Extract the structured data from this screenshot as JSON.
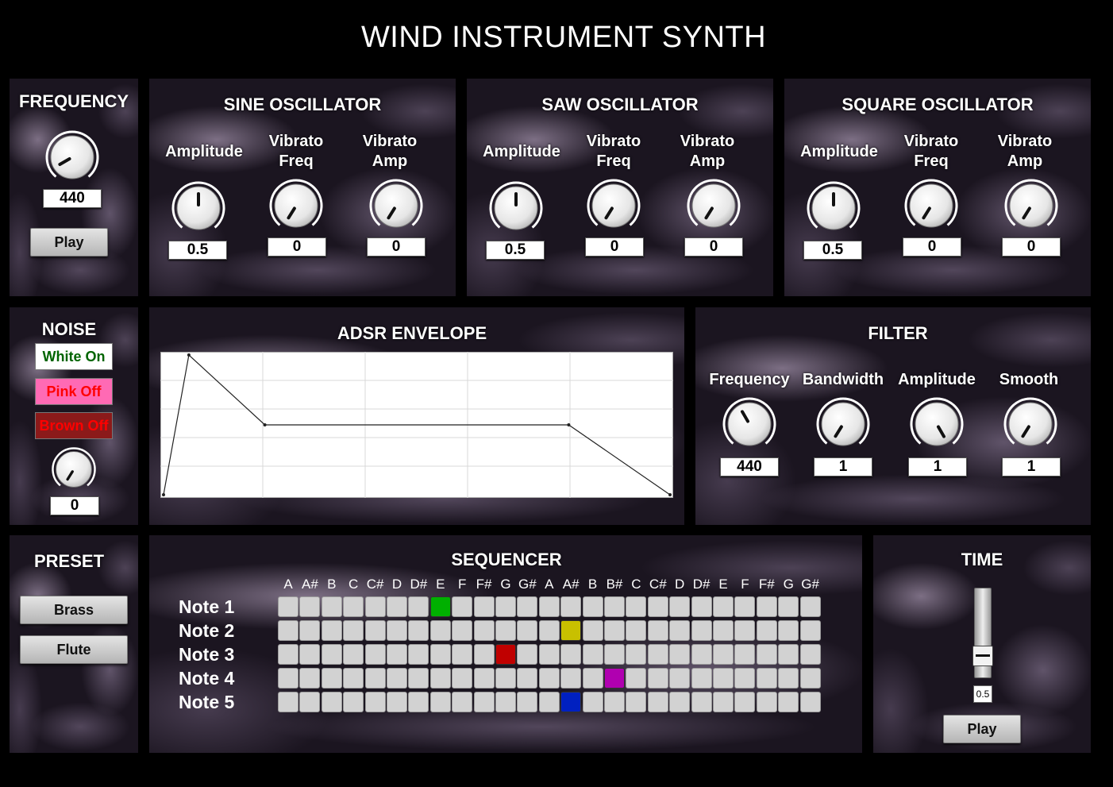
{
  "app_title": "WIND INSTRUMENT SYNTH",
  "frequency": {
    "title": "FREQUENCY",
    "value": "440",
    "play_label": "Play"
  },
  "sine": {
    "title": "SINE OSCILLATOR",
    "amp_label": "Amplitude",
    "vf_label": "Vibrato Freq",
    "va_label": "Vibrato Amp",
    "amp_value": "0.5",
    "vf_value": "0",
    "va_value": "0"
  },
  "saw": {
    "title": "SAW OSCILLATOR",
    "amp_label": "Amplitude",
    "vf_label": "Vibrato Freq",
    "va_label": "Vibrato Amp",
    "amp_value": "0.5",
    "vf_value": "0",
    "va_value": "0"
  },
  "square": {
    "title": "SQUARE OSCILLATOR",
    "amp_label": "Amplitude",
    "vf_label": "Vibrato Freq",
    "va_label": "Vibrato Amp",
    "amp_value": "0.5",
    "vf_value": "0",
    "va_value": "0"
  },
  "noise": {
    "title": "NOISE",
    "white_label": "White On",
    "pink_label": "Pink Off",
    "brown_label": "Brown Off",
    "value": "0",
    "colors": {
      "white_text": "#006400",
      "pink_bg": "#ff69b4",
      "pink_text": "#ff0000",
      "brown_bg": "#8b1a1a",
      "brown_text": "#ff0000"
    }
  },
  "adsr": {
    "title": "ADSR ENVELOPE",
    "points": [
      [
        0,
        0
      ],
      [
        0.05,
        1
      ],
      [
        0.2,
        0.5
      ],
      [
        0.8,
        0.5
      ],
      [
        1,
        0
      ]
    ]
  },
  "filter": {
    "title": "FILTER",
    "freq_label": "Frequency",
    "bw_label": "Bandwidth",
    "amp_label": "Amplitude",
    "smooth_label": "Smooth",
    "freq_value": "440",
    "bw_value": "1",
    "amp_value": "1",
    "smooth_value": "1"
  },
  "preset": {
    "title": "PRESET",
    "brass_label": "Brass",
    "flute_label": "Flute"
  },
  "sequencer": {
    "title": "SEQUENCER",
    "columns": [
      "A",
      "A#",
      "B",
      "C",
      "C#",
      "D",
      "D#",
      "E",
      "F",
      "F#",
      "G",
      "G#",
      "A",
      "A#",
      "B",
      "B#",
      "C",
      "C#",
      "D",
      "D#",
      "E",
      "F",
      "F#",
      "G",
      "G#"
    ],
    "rows": [
      "Note 1",
      "Note 2",
      "Note 3",
      "Note 4",
      "Note 5"
    ],
    "active": [
      {
        "row": 0,
        "col": 7,
        "color": "#00b000"
      },
      {
        "row": 1,
        "col": 13,
        "color": "#c8c000"
      },
      {
        "row": 2,
        "col": 10,
        "color": "#c00000"
      },
      {
        "row": 3,
        "col": 15,
        "color": "#b000b0"
      },
      {
        "row": 4,
        "col": 13,
        "color": "#0020c0"
      }
    ]
  },
  "time": {
    "title": "TIME",
    "value": "0.5",
    "play_label": "Play"
  }
}
